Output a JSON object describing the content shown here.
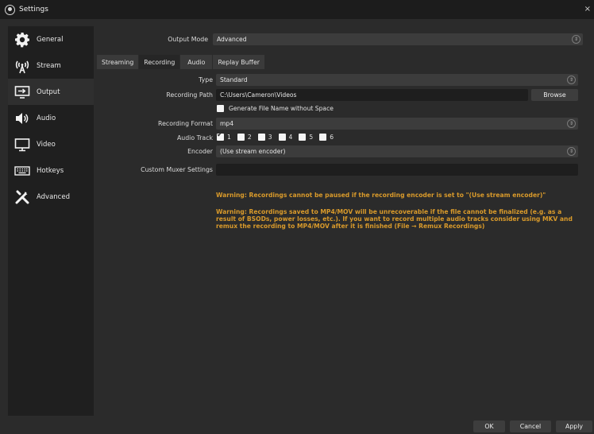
{
  "window": {
    "title": "Settings",
    "close_label": "×"
  },
  "sidebar": {
    "items": [
      {
        "label": "General"
      },
      {
        "label": "Stream"
      },
      {
        "label": "Output"
      },
      {
        "label": "Audio"
      },
      {
        "label": "Video"
      },
      {
        "label": "Hotkeys"
      },
      {
        "label": "Advanced"
      }
    ]
  },
  "output_mode": {
    "label": "Output Mode",
    "value": "Advanced"
  },
  "tabs": [
    {
      "label": "Streaming"
    },
    {
      "label": "Recording"
    },
    {
      "label": "Audio"
    },
    {
      "label": "Replay Buffer"
    }
  ],
  "recording": {
    "type": {
      "label": "Type",
      "value": "Standard"
    },
    "path": {
      "label": "Recording Path",
      "value": "C:\\Users\\Cameron\\Videos",
      "browse_label": "Browse"
    },
    "no_space": {
      "label": "Generate File Name without Space",
      "checked": false
    },
    "format": {
      "label": "Recording Format",
      "value": "mp4"
    },
    "audio_track": {
      "label": "Audio Track",
      "tracks": [
        {
          "num": "1",
          "checked": true
        },
        {
          "num": "2",
          "checked": false
        },
        {
          "num": "3",
          "checked": false
        },
        {
          "num": "4",
          "checked": false
        },
        {
          "num": "5",
          "checked": false
        },
        {
          "num": "6",
          "checked": false
        }
      ]
    },
    "encoder": {
      "label": "Encoder",
      "value": "(Use stream encoder)"
    },
    "muxer": {
      "label": "Custom Muxer Settings",
      "value": ""
    }
  },
  "warnings": {
    "pause": "Warning: Recordings cannot be paused if the recording encoder is set to \"(Use stream encoder)\"",
    "mp4_line1": "Warning: Recordings saved to MP4/MOV will be unrecoverable if the file cannot be finalized (e.g. as a",
    "mp4_line2": "result of BSODs, power losses, etc.). If you want to record multiple audio tracks consider using MKV and",
    "mp4_line3": "remux the recording to MP4/MOV after it is finished (File → Remux Recordings)"
  },
  "buttons": {
    "ok": "OK",
    "cancel": "Cancel",
    "apply": "Apply"
  },
  "colors": {
    "warning": "#d99a2b",
    "background": "#2b2b2b",
    "sidebar": "#1f1f1f"
  }
}
